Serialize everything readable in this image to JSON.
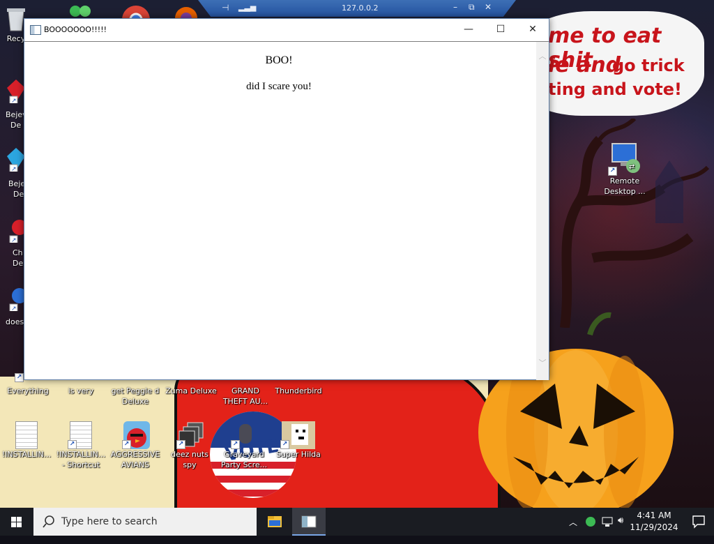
{
  "remote_bar": {
    "title": "127.0.0.2",
    "pin_icon": "pin-icon",
    "signal_icon": "signal-bars-icon",
    "minimize": "–",
    "restore": "⧉",
    "close": "✕"
  },
  "wallpaper": {
    "speech_line1": "me to eat shit",
    "speech_line2a": "ie and",
    "speech_line2b": "go trick",
    "speech_line3": "ting and vote!",
    "pumpkin_color": "#f6a11c",
    "red_color": "#e32219",
    "cream_color": "#f3e7b8"
  },
  "desktop": {
    "left_column": [
      {
        "label": "Recy",
        "icon": "recycle-bin-icon"
      },
      {
        "label": "Bejev\nDe",
        "icon": "bejeweled-icon"
      },
      {
        "label": "Beje\nDe",
        "icon": "bejeweled-icon"
      },
      {
        "label": "Ch\nDe",
        "icon": "chuzzle-icon"
      },
      {
        "label": "does",
        "icon": "app-icon"
      }
    ],
    "row1": [
      {
        "label": "Everything",
        "icon": "everything-icon"
      },
      {
        "label": "is very",
        "icon": "app-icon"
      },
      {
        "label": "get Peggle d\nDeluxe",
        "icon": "peggle-icon"
      },
      {
        "label": "Zuma Deluxe",
        "icon": "zuma-icon"
      },
      {
        "label": "GRAND\nTHEFT AU...",
        "icon": "gta-icon"
      },
      {
        "label": "Thunderbird",
        "icon": "thunderbird-icon"
      }
    ],
    "row2": [
      {
        "label": "!INSTALLIN...",
        "icon": "document-icon"
      },
      {
        "label": "!INSTALLIN...\n- Shortcut",
        "icon": "document-icon"
      },
      {
        "label": "AGGRESSIVE\nAVIANS",
        "icon": "angry-bird-icon"
      },
      {
        "label": "deez nuts spy",
        "icon": "window-stack-icon"
      },
      {
        "label": "Graveyard\nParty Scre...",
        "icon": "graveyard-icon"
      },
      {
        "label": "Super Hilda",
        "icon": "pixel-dog-icon"
      }
    ],
    "remote_desktop": {
      "label": "Remote\nDesktop ...",
      "icon": "remote-desktop-icon"
    }
  },
  "window": {
    "title": "BOOOOOOO!!!!!",
    "heading": "BOO!",
    "body": "did I scare you!",
    "minimize": "—",
    "maximize": "☐",
    "close": "✕"
  },
  "taskbar": {
    "search_placeholder": "Type here to search",
    "time": "4:41 AM",
    "date": "11/29/2024",
    "apps": [
      {
        "name": "file-explorer-icon",
        "active": false
      },
      {
        "name": "booo-window-icon",
        "active": true
      }
    ],
    "tray_icons": [
      "chevron-up-icon",
      "network-people-icon",
      "network-icon",
      "volume-icon"
    ]
  }
}
